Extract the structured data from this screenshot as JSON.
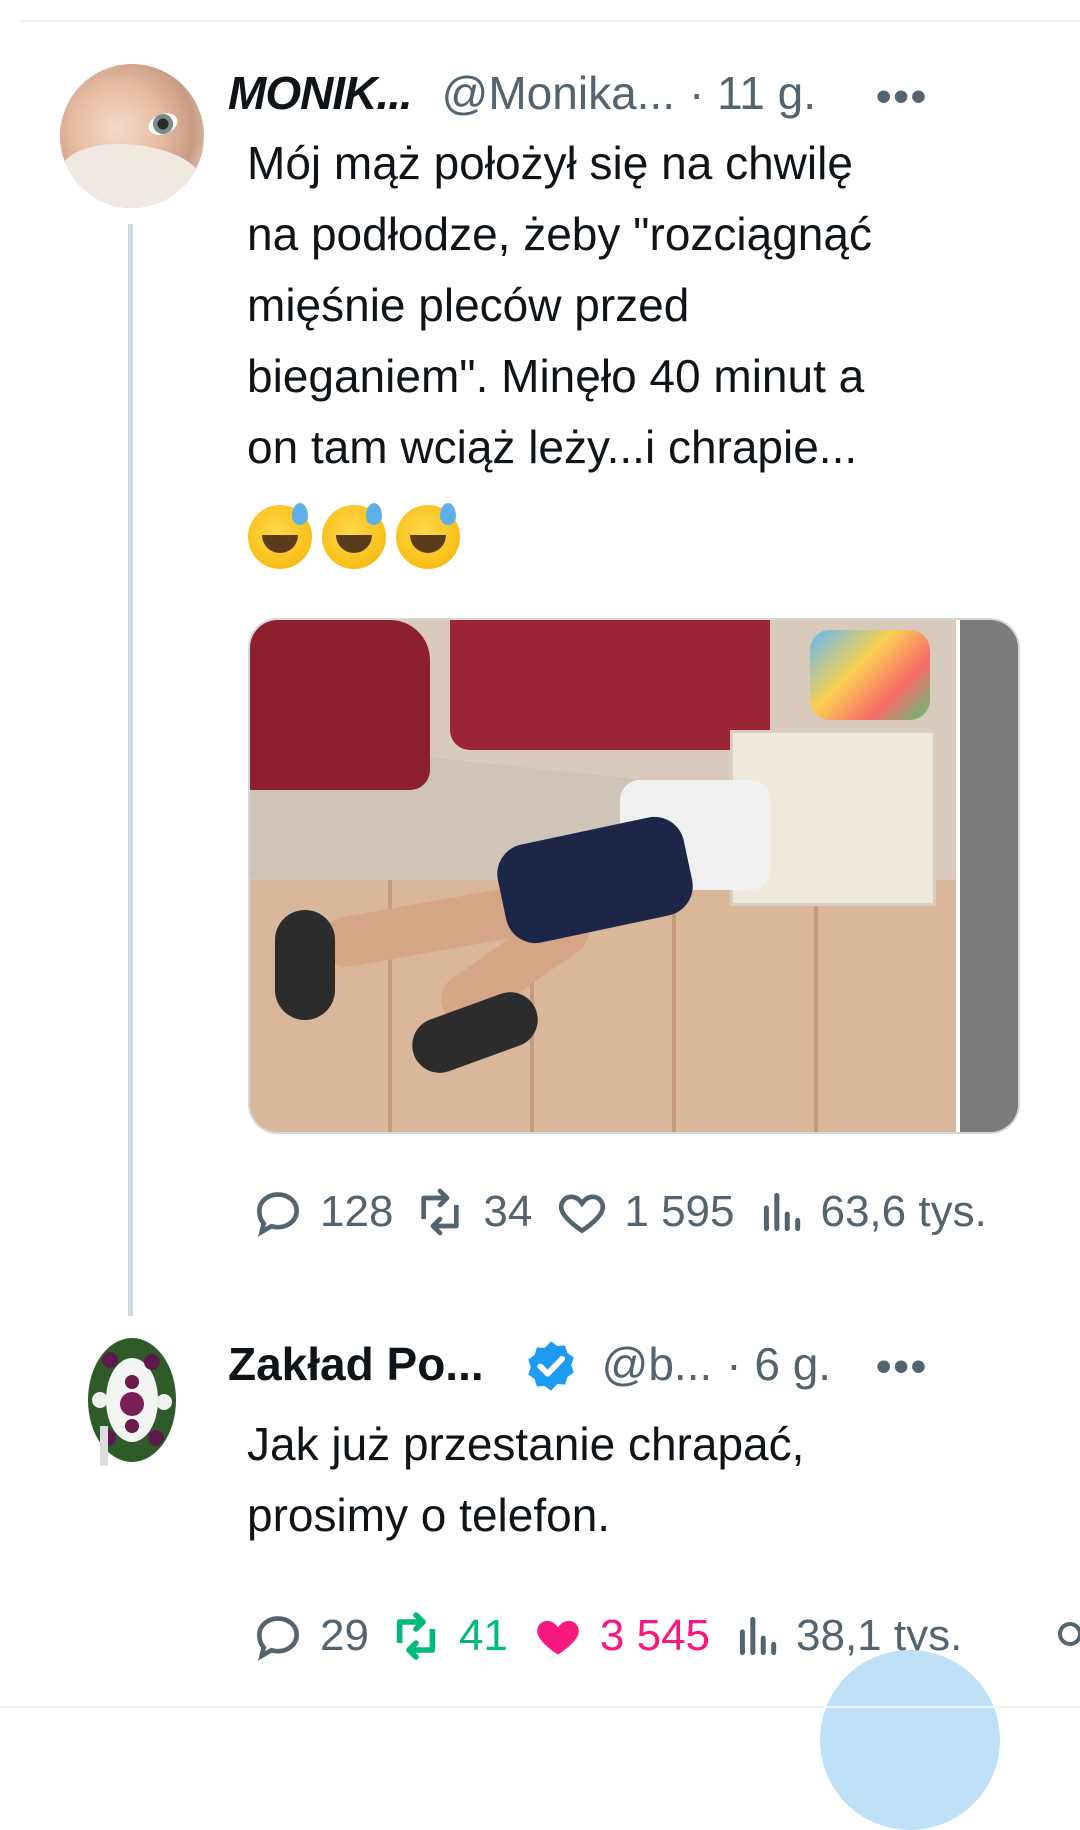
{
  "tweets": [
    {
      "name": "MONIK...",
      "handle": "@Monika...",
      "time": "· 11 g.",
      "more": "•••",
      "text": "Mój mąż położył się na chwilę\nna podłodze, żeby \"rozciągnąć\nmięśnie pleców przed\nbieganiem\". Minęło 40 minut a\non tam wciąż leży...i chrapie...",
      "emoji": [
        "sweat-smile",
        "sweat-smile",
        "sweat-smile"
      ],
      "stats": {
        "replies": "128",
        "retweets": "34",
        "likes": "1 595",
        "views": "63,6 tys."
      }
    },
    {
      "name": "Zakład Po...",
      "handle": "@b...",
      "time": "· 6 g.",
      "more": "•••",
      "verified": true,
      "text": "Jak już przestanie chrapać,\nprosimy o telefon.",
      "stats": {
        "replies": "29",
        "retweets": "41",
        "likes": "3 545",
        "views": "38,1 tys."
      },
      "state": {
        "retweeted": true,
        "liked": true
      }
    }
  ],
  "colors": {
    "text": "#0f1419",
    "secondary": "#536471",
    "retweet_active": "#00ba7c",
    "like_active": "#f91880",
    "verified": "#1d9bf0",
    "thread_line": "#cfd9de"
  },
  "icons": [
    "reply-icon",
    "retweet-icon",
    "like-icon",
    "views-icon",
    "verified-badge-icon",
    "more-icon"
  ]
}
